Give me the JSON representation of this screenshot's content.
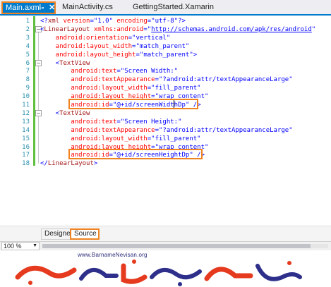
{
  "tabs": [
    {
      "label": "Main.axml",
      "active": true
    },
    {
      "label": "MainActivity.cs",
      "active": false
    },
    {
      "label": "GettingStarted.Xamarin",
      "active": false
    }
  ],
  "editor": {
    "lines": [
      {
        "n": "1",
        "fold": "",
        "parts": [
          [
            "pun",
            "<?"
          ],
          [
            "tag",
            "xml"
          ],
          [
            "att",
            " version"
          ],
          [
            "pun",
            "=\""
          ],
          [
            "val",
            "1.0"
          ],
          [
            "pun",
            "\""
          ],
          [
            "att",
            " encoding"
          ],
          [
            "pun",
            "=\""
          ],
          [
            "val",
            "utf-8"
          ],
          [
            "pun",
            "\"?>"
          ]
        ]
      },
      {
        "n": "2",
        "fold": "-",
        "parts": [
          [
            "pun",
            "<"
          ],
          [
            "tag",
            "LinearLayout"
          ],
          [
            "att",
            " xmlns:android"
          ],
          [
            "pun",
            "=\""
          ],
          [
            "url",
            "http://schemas.android.com/apk/res/android"
          ],
          [
            "pun",
            "\""
          ]
        ]
      },
      {
        "n": "3",
        "fold": "",
        "parts": [
          [
            "att",
            "    android:orientation"
          ],
          [
            "pun",
            "=\""
          ],
          [
            "val",
            "vertical"
          ],
          [
            "pun",
            "\""
          ]
        ]
      },
      {
        "n": "4",
        "fold": "",
        "parts": [
          [
            "att",
            "    android:layout_width"
          ],
          [
            "pun",
            "=\""
          ],
          [
            "val",
            "match_parent"
          ],
          [
            "pun",
            "\""
          ]
        ]
      },
      {
        "n": "5",
        "fold": "",
        "parts": [
          [
            "att",
            "    android:layout_height"
          ],
          [
            "pun",
            "=\""
          ],
          [
            "val",
            "match_parent"
          ],
          [
            "pun",
            "\">"
          ]
        ]
      },
      {
        "n": "6",
        "fold": "-",
        "parts": [
          [
            "pun",
            "    <"
          ],
          [
            "tag",
            "TextView"
          ]
        ]
      },
      {
        "n": "7",
        "fold": "",
        "parts": [
          [
            "att",
            "        android:text"
          ],
          [
            "pun",
            "=\""
          ],
          [
            "val",
            "Screen Width:"
          ],
          [
            "pun",
            "\""
          ]
        ]
      },
      {
        "n": "8",
        "fold": "",
        "parts": [
          [
            "att",
            "        android:textAppearance"
          ],
          [
            "pun",
            "=\""
          ],
          [
            "val",
            "?android:attr/textAppearanceLarge"
          ],
          [
            "pun",
            "\""
          ]
        ]
      },
      {
        "n": "9",
        "fold": "",
        "parts": [
          [
            "att",
            "        android:layout_width"
          ],
          [
            "pun",
            "=\""
          ],
          [
            "val",
            "fill_parent"
          ],
          [
            "pun",
            "\""
          ]
        ]
      },
      {
        "n": "10",
        "fold": "",
        "parts": [
          [
            "att",
            "        android:layout_height"
          ],
          [
            "pun",
            "=\""
          ],
          [
            "val",
            "wrap_content"
          ],
          [
            "pun",
            "\""
          ]
        ]
      },
      {
        "n": "11",
        "fold": "",
        "parts": [
          [
            "att",
            "        android:id"
          ],
          [
            "pun",
            "=\""
          ],
          [
            "val",
            "@+id/screenWidthDp"
          ],
          [
            "pun",
            "\" />"
          ]
        ]
      },
      {
        "n": "12",
        "fold": "-",
        "parts": [
          [
            "pun",
            "    <"
          ],
          [
            "tag",
            "TextView"
          ]
        ]
      },
      {
        "n": "13",
        "fold": "",
        "parts": [
          [
            "att",
            "        android:text"
          ],
          [
            "pun",
            "=\""
          ],
          [
            "val",
            "Screen Height:"
          ],
          [
            "pun",
            "\""
          ]
        ]
      },
      {
        "n": "14",
        "fold": "",
        "parts": [
          [
            "att",
            "        android:textAppearance"
          ],
          [
            "pun",
            "=\""
          ],
          [
            "val",
            "?android:attr/textAppearanceLarge"
          ],
          [
            "pun",
            "\""
          ]
        ]
      },
      {
        "n": "15",
        "fold": "",
        "parts": [
          [
            "att",
            "        android:layout_width"
          ],
          [
            "pun",
            "=\""
          ],
          [
            "val",
            "fill_parent"
          ],
          [
            "pun",
            "\""
          ]
        ]
      },
      {
        "n": "16",
        "fold": "",
        "parts": [
          [
            "att",
            "        android:layout_height"
          ],
          [
            "pun",
            "=\""
          ],
          [
            "val",
            "wrap_content"
          ],
          [
            "pun",
            "\""
          ]
        ]
      },
      {
        "n": "17",
        "fold": "",
        "parts": [
          [
            "att",
            "        android:id"
          ],
          [
            "pun",
            "=\""
          ],
          [
            "val",
            "@+id/screenHeightDp"
          ],
          [
            "pun",
            "\" />"
          ]
        ]
      },
      {
        "n": "18",
        "fold": "",
        "parts": [
          [
            "pun",
            "</"
          ],
          [
            "tag",
            "LinearLayout"
          ],
          [
            "pun",
            ">"
          ]
        ]
      }
    ]
  },
  "subtabs": {
    "designer": "Designer",
    "source": "Source"
  },
  "statusbar": {
    "zoom": "100 %"
  },
  "watermark": {
    "url": "www.BarnameNevisan.org"
  },
  "colors": {
    "accent": "#007acc",
    "highlight": "#f08321",
    "line_number": "#2b91af",
    "change_marker": "#5fbf3f",
    "tag": "#a31515",
    "attribute": "#ff0000",
    "value": "#0000ff"
  }
}
